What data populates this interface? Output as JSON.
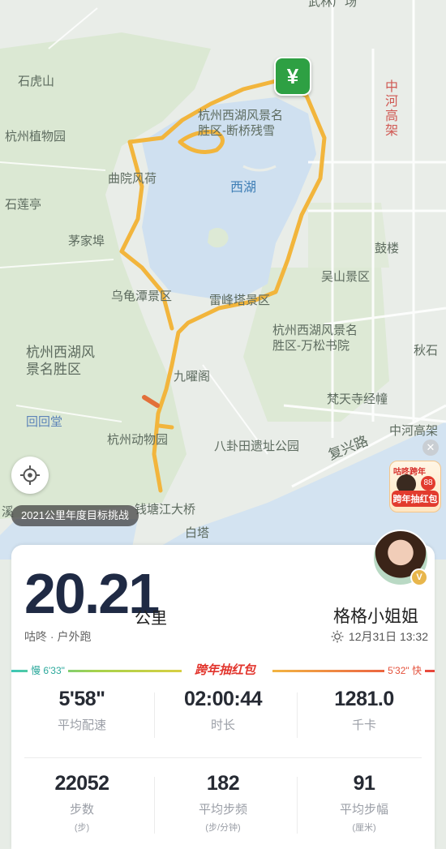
{
  "map": {
    "labels": {
      "top_street": "武林广场",
      "shihushan": "石虎山",
      "zhonghe_elevated": "中河高架",
      "botanical_garden": "杭州植物园",
      "duanqiao": "杭州西湖风景名\n胜区-断桥残雪",
      "quyuan": "曲院风荷",
      "xihu": "西湖",
      "shilianting": "石莲亭",
      "maojiabu": "茅家埠",
      "gulou": "鼓楼",
      "wushan": "吴山景区",
      "wuguitan": "乌龟潭景区",
      "leifeng": "雷峰塔景区",
      "hz_xihu_area": "杭州西湖风\n景名胜区",
      "wansong": "杭州西湖风景名\n胜区-万松书院",
      "qiushi": "秋石",
      "jiuyao": "九曜阁",
      "fantiansi": "梵天寺经幢",
      "huihuitang": "回回堂",
      "zoo": "杭州动物园",
      "zhonghe_elevated2": "中河高架",
      "bagua": "八卦田遗址公园",
      "fuxing": "复兴路",
      "xi": "溪",
      "qiantang_bridge": "钱塘江大桥",
      "baita": "白塔"
    },
    "start_marker_glyph": "¥",
    "challenge_badge": "2021公里年度目标挑战",
    "promo": {
      "top_text": "咕咚跨年",
      "bottom_text": "跨年抽红包",
      "number": "88"
    },
    "colors": {
      "route": "#f2b53c",
      "lake": "#cfe0f0",
      "green": "#dde9d5",
      "start": "#2ea043"
    }
  },
  "summary": {
    "distance": "20.21",
    "unit": "公里",
    "activity_type": "咕咚 · 户外跑",
    "username": "格格小姐姐",
    "date": "12月31日 13:32"
  },
  "pace_bar": {
    "slow_label": "慢 6'33\"",
    "fast_label": "5'32\" 快",
    "promo": "跨年抽红包"
  },
  "stats": [
    {
      "value": "5'58\"",
      "label": "平均配速",
      "sub": ""
    },
    {
      "value": "02:00:44",
      "label": "时长",
      "sub": ""
    },
    {
      "value": "1281.0",
      "label": "千卡",
      "sub": ""
    },
    {
      "value": "22052",
      "label": "步数",
      "sub": "(步)"
    },
    {
      "value": "182",
      "label": "平均步频",
      "sub": "(步/分钟)"
    },
    {
      "value": "91",
      "label": "平均步幅",
      "sub": "(厘米)"
    }
  ]
}
